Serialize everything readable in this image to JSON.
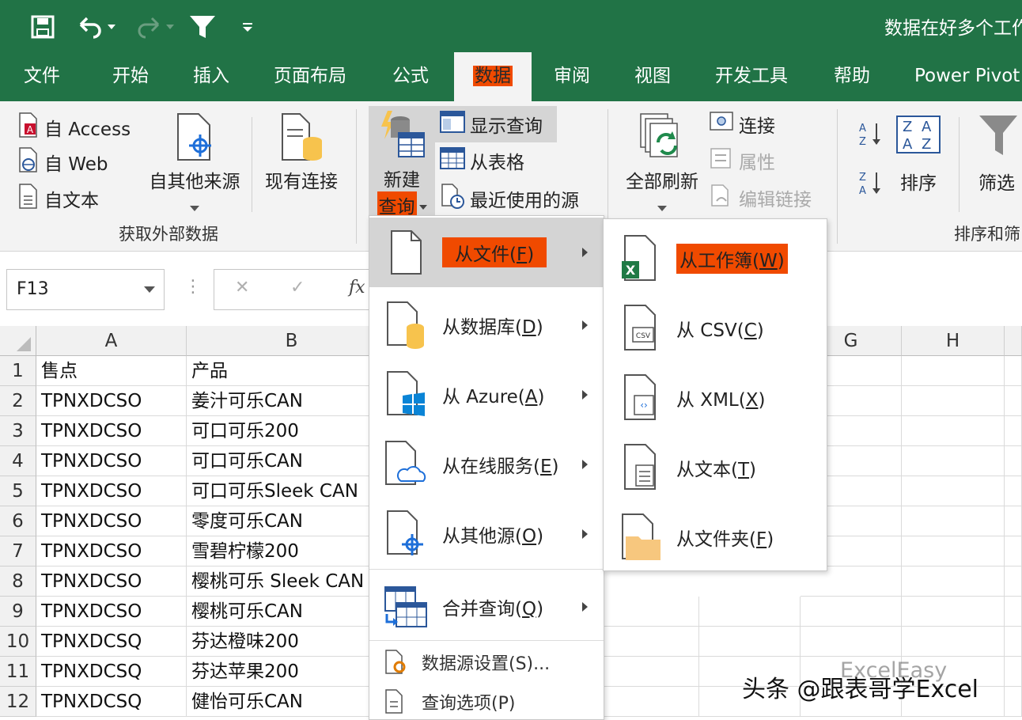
{
  "app": {
    "title": "数据在好多个工作"
  },
  "tabs": [
    {
      "label": "文件",
      "active": false
    },
    {
      "label": "开始",
      "active": false
    },
    {
      "label": "插入",
      "active": false
    },
    {
      "label": "页面布局",
      "active": false
    },
    {
      "label": "公式",
      "active": false
    },
    {
      "label": "数据",
      "active": true
    },
    {
      "label": "审阅",
      "active": false
    },
    {
      "label": "视图",
      "active": false
    },
    {
      "label": "开发工具",
      "active": false
    },
    {
      "label": "帮助",
      "active": false
    },
    {
      "label": "Power Pivot",
      "active": false
    }
  ],
  "ribbon": {
    "get_external": {
      "access": "自 Access",
      "web": "自 Web",
      "text": "自文本",
      "other_sources": "自其他来源",
      "existing_connections": "现有连接",
      "group_label": "获取外部数据"
    },
    "new_query": {
      "label_line1": "新建",
      "label_line2": "查询",
      "show_queries": "显示查询",
      "from_table": "从表格",
      "recent_sources": "最近使用的源"
    },
    "connections": {
      "refresh_all": "全部刷新",
      "connections": "连接",
      "properties": "属性",
      "edit_links": "编辑链接"
    },
    "sort_filter": {
      "sort_az": "A↓Z",
      "sort_za": "Z↓A",
      "sort": "排序",
      "filter": "筛选",
      "group_label": "排序和筛"
    }
  },
  "formula_bar": {
    "name_box": "F13",
    "cancel": "✕",
    "enter": "✓",
    "fx": "fx"
  },
  "columns": [
    "A",
    "B",
    "G",
    "H"
  ],
  "rows": [
    {
      "num": "1",
      "a": "售点",
      "b": "产品"
    },
    {
      "num": "2",
      "a": "TPNXDCSO",
      "b": "姜汁可乐CAN"
    },
    {
      "num": "3",
      "a": "TPNXDCSO",
      "b": "可口可乐200"
    },
    {
      "num": "4",
      "a": "TPNXDCSO",
      "b": "可口可乐CAN"
    },
    {
      "num": "5",
      "a": "TPNXDCSO",
      "b": "可口可乐Sleek CAN"
    },
    {
      "num": "6",
      "a": "TPNXDCSO",
      "b": "零度可乐CAN"
    },
    {
      "num": "7",
      "a": "TPNXDCSO",
      "b": "雪碧柠檬200"
    },
    {
      "num": "8",
      "a": "TPNXDCSO",
      "b": "樱桃可乐 Sleek CAN"
    },
    {
      "num": "9",
      "a": "TPNXDCSO",
      "b": "樱桃可乐CAN"
    },
    {
      "num": "10",
      "a": "TPNXDCSQ",
      "b": "芬达橙味200"
    },
    {
      "num": "11",
      "a": "TPNXDCSQ",
      "b": "芬达苹果200"
    },
    {
      "num": "12",
      "a": "TPNXDCSQ",
      "b": "健怡可乐CAN"
    }
  ],
  "menu_new_query": {
    "items": [
      {
        "label": "从文件",
        "key": "F",
        "icon": "file-icon"
      },
      {
        "label": "从数据库",
        "key": "D",
        "icon": "database-icon"
      },
      {
        "label": "从 Azure",
        "key": "A",
        "icon": "azure-icon"
      },
      {
        "label": "从在线服务",
        "key": "E",
        "icon": "cloud-icon"
      },
      {
        "label": "从其他源",
        "key": "O",
        "icon": "other-source-icon"
      },
      {
        "label": "合并查询",
        "key": "Q",
        "icon": "merge-query-icon"
      }
    ],
    "data_source_settings": "数据源设置(S)...",
    "query_options": "查询选项(P)"
  },
  "menu_from_file": {
    "items": [
      {
        "label": "从工作簿",
        "key": "W",
        "icon": "excel-workbook-icon"
      },
      {
        "label": "从 CSV",
        "key": "C",
        "icon": "csv-icon"
      },
      {
        "label": "从 XML",
        "key": "X",
        "icon": "xml-icon"
      },
      {
        "label": "从文本",
        "key": "T",
        "icon": "text-file-icon"
      },
      {
        "label": "从文件夹",
        "key": "F",
        "icon": "folder-icon"
      }
    ]
  },
  "watermark": {
    "text": "头条 @跟表哥学Excel",
    "faint": "ExcelEasy"
  },
  "colors": {
    "excel_green": "#217346",
    "highlight_orange": "#f04a00"
  }
}
